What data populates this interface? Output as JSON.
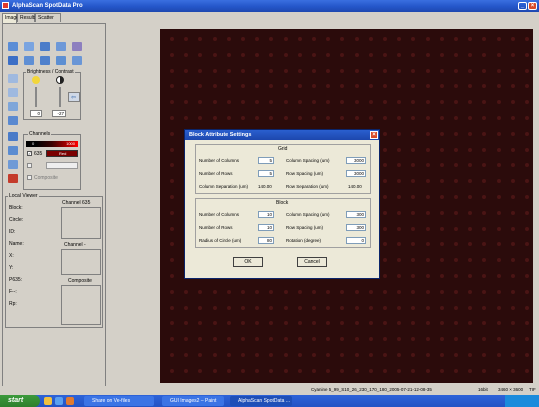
{
  "app": {
    "title": "AlphaScan SpotData Pro",
    "tabs": [
      "Image",
      "Results",
      "Scatter Plot"
    ],
    "active_tab": "Image"
  },
  "colors": {
    "canvas_bg": "#2b0b0b",
    "spot": "#4a1414",
    "accent": "#2456c9"
  },
  "toolbar": {
    "icons": [
      "open-folder-icon",
      "stack-icon",
      "grid-icon",
      "crosshair-icon",
      "person-icon",
      "save-icon",
      "search-icon",
      "spots-icon",
      "measure-icon",
      "export-icon",
      "zoom-in-icon",
      "zoom-out-icon",
      "pan-icon",
      "fit-icon",
      "layers-icon",
      "channel-icon",
      "select-icon",
      "color-icon"
    ]
  },
  "brightness": {
    "title": "Brightness / Contrast",
    "brightness_value": "0",
    "contrast_value": "-27"
  },
  "channels": {
    "title": "Channels",
    "ch1_min": "0",
    "ch1_max": "1000",
    "ch1_label": "635",
    "ch1_color": "Red",
    "ch3_label": "Composite"
  },
  "local_viewer": {
    "title": "Local Viewer",
    "fields": [
      "Block:",
      "Circle:",
      "ID:",
      "Name:",
      "X:",
      "Y:",
      "P635:",
      "F--:",
      "Rp:"
    ],
    "channel_a": "Channel 635",
    "channel_b": "Channel -",
    "composite": "Composite"
  },
  "dialog": {
    "title": "Block Attribute Settings",
    "grid": {
      "title": "Grid",
      "num_columns_label": "Number of Columns",
      "num_columns": "5",
      "num_rows_label": "Number of Rows",
      "num_rows": "5",
      "col_sep_label": "Column Separation (um)",
      "col_sep": "140.00",
      "col_spacing_label": "Column Spacing (um)",
      "col_spacing": "3000",
      "row_spacing_label": "Row Spacing (um)",
      "row_spacing": "3000",
      "row_sep_label": "Row Separation (um)",
      "row_sep": "140.00"
    },
    "block": {
      "title": "Block",
      "num_columns_label": "Number of Columns",
      "num_columns": "10",
      "num_rows_label": "Number of Rows",
      "num_rows": "10",
      "radius_label": "Radius of Circle (um)",
      "radius": "80",
      "col_spacing_label": "Column Spacing (um)",
      "col_spacing": "300",
      "row_spacing_label": "Row Spacing (um)",
      "row_spacing": "300",
      "rotation_label": "Rotation (degree)",
      "rotation": "0"
    },
    "ok_label": "OK",
    "cancel_label": "Cancel"
  },
  "status": {
    "file": "Cyanine 5_99_S10_26_230_170_180_2005-07-21-12-08-35",
    "bits": "16bit",
    "size": "3460 × 3600",
    "format": "TIF"
  },
  "taskbar": {
    "start_label": "start",
    "tasks": [
      "Share on Ve-files",
      "GUI Images2 – Paint",
      "AlphaScan SpotData ..."
    ]
  }
}
